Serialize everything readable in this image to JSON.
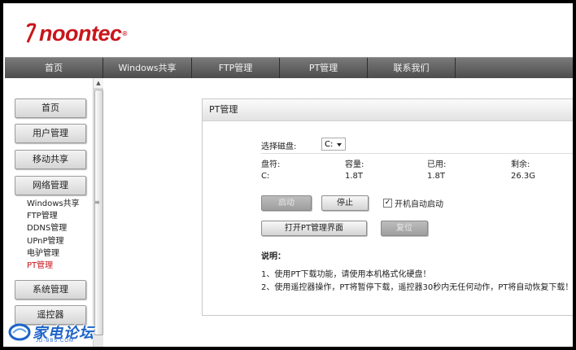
{
  "brand": {
    "name": "noontec",
    "mark": "®"
  },
  "topnav": [
    {
      "label": "首页"
    },
    {
      "label": "Windows共享"
    },
    {
      "label": "FTP管理"
    },
    {
      "label": "PT管理"
    },
    {
      "label": "联系我们"
    }
  ],
  "sidebar": {
    "buttons": [
      "首页",
      "用户管理",
      "移动共享",
      "网络管理",
      "系统管理",
      "遥控器"
    ],
    "network_submenu": [
      "Windows共享",
      "FTP管理",
      "DDNS管理",
      "UPnP管理",
      "电驴管理",
      "PT管理"
    ]
  },
  "panel": {
    "title": "PT管理",
    "disk_label": "选择磁盘:",
    "disk_selected": "C:",
    "columns": [
      "盘符:",
      "容量:",
      "已用:",
      "剩余:"
    ],
    "row": [
      "C:",
      "1.8T",
      "1.8T",
      "26.3G"
    ],
    "start_label": "启动",
    "stop_label": "停止",
    "autostart_label": "开机自动启动",
    "autostart_checked": "✓",
    "open_label": "打开PT管理界面",
    "reset_label": "复位",
    "notes_title": "说明：",
    "notes": [
      "1、使用PT下载功能，请使用本机格式化硬盘！",
      "2、使用遥控器操作，PT将暂停下载，遥控器30秒内无任何动作，PT将自动恢复下载！"
    ]
  },
  "watermark": {
    "name": "家电论坛",
    "url": "JD-BBS.COM"
  },
  "colors": {
    "brand_red": "#c8151b",
    "nav_bg": "#5a5a5a",
    "watermark_blue": "#1e64c8"
  }
}
